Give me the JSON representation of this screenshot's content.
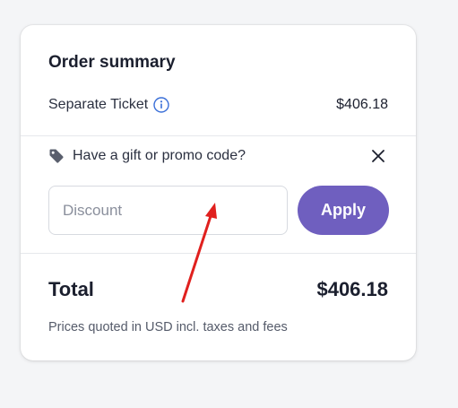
{
  "order_summary": {
    "title": "Order summary",
    "ticket": {
      "label": "Separate Ticket",
      "price": "$406.18",
      "info_icon": "info-icon"
    },
    "promo": {
      "prompt": "Have a gift or promo code?",
      "tag_icon": "tag-icon",
      "close_icon": "close-icon",
      "input_value": "",
      "input_placeholder": "Discount",
      "apply_label": "Apply"
    },
    "total": {
      "label": "Total",
      "value": "$406.18"
    },
    "footnote": "Prices quoted in USD incl. taxes and fees"
  },
  "colors": {
    "accent": "#6f5fbf",
    "text_primary": "#1b1f2e",
    "text_muted": "#555b6a",
    "info_blue": "#3a6fd8",
    "annotation_arrow": "#e0201e"
  }
}
